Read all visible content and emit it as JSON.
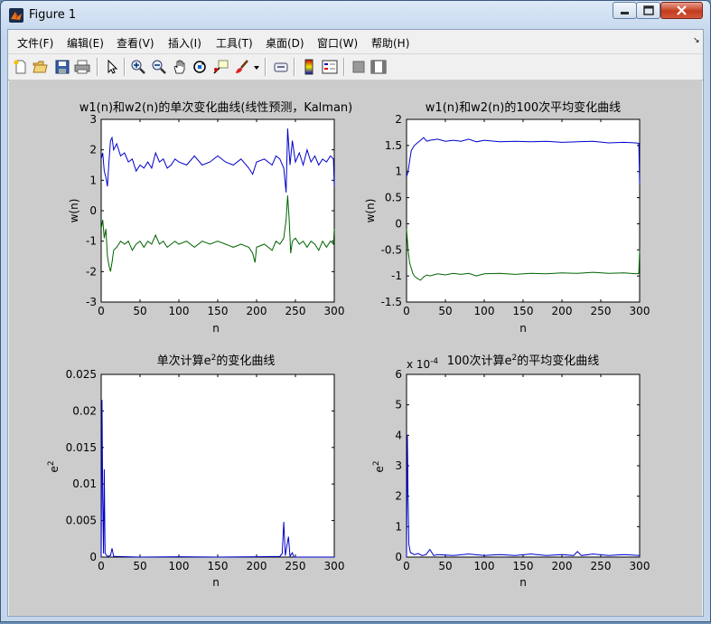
{
  "window": {
    "title": "Figure 1"
  },
  "menu": [
    "文件(F)",
    "编辑(E)",
    "查看(V)",
    "插入(I)",
    "工具(T)",
    "桌面(D)",
    "窗口(W)",
    "帮助(H)"
  ],
  "toolbar_icons": [
    "new-figure-icon",
    "open-icon",
    "save-icon",
    "print-icon",
    "pointer-icon",
    "zoom-in-icon",
    "zoom-out-icon",
    "pan-icon",
    "rotate-3d-icon",
    "data-cursor-icon",
    "brush-icon",
    "dropdown-arrow-icon",
    "link-plot-icon",
    "colorbar-icon",
    "legend-icon",
    "hide-plot-tools-icon",
    "show-plot-tools-icon"
  ],
  "colors": {
    "series1": "#0000cc",
    "series2": "#006400",
    "figure_bg": "#cccccc"
  },
  "chart_data": [
    {
      "type": "line",
      "title": "w1(n)和w2(n)的单次变化曲线(线性预测，Kalman)",
      "xlabel": "n",
      "ylabel": "w(n)",
      "xlim": [
        0,
        300
      ],
      "ylim": [
        -3,
        3
      ],
      "xticks": [
        "0",
        "50",
        "100",
        "150",
        "200",
        "250",
        "300"
      ],
      "yticks": [
        "-3",
        "-2",
        "-1",
        "0",
        "1",
        "2",
        "3"
      ],
      "series": [
        {
          "color": "#0000cc",
          "points": [
            [
              0,
              1.7
            ],
            [
              2,
              1.9
            ],
            [
              4,
              1.3
            ],
            [
              6,
              1.1
            ],
            [
              8,
              0.8
            ],
            [
              10,
              1.6
            ],
            [
              12,
              2.3
            ],
            [
              14,
              2.4
            ],
            [
              16,
              2.0
            ],
            [
              20,
              2.2
            ],
            [
              25,
              1.8
            ],
            [
              30,
              1.9
            ],
            [
              35,
              1.6
            ],
            [
              40,
              1.7
            ],
            [
              45,
              1.3
            ],
            [
              50,
              1.5
            ],
            [
              55,
              1.4
            ],
            [
              60,
              1.6
            ],
            [
              65,
              1.4
            ],
            [
              70,
              1.9
            ],
            [
              75,
              1.6
            ],
            [
              80,
              1.7
            ],
            [
              85,
              1.4
            ],
            [
              90,
              1.5
            ],
            [
              95,
              1.7
            ],
            [
              100,
              1.6
            ],
            [
              110,
              1.5
            ],
            [
              120,
              1.8
            ],
            [
              130,
              1.5
            ],
            [
              140,
              1.6
            ],
            [
              150,
              1.8
            ],
            [
              160,
              1.6
            ],
            [
              170,
              1.5
            ],
            [
              180,
              1.7
            ],
            [
              190,
              1.4
            ],
            [
              195,
              1.2
            ],
            [
              200,
              1.6
            ],
            [
              210,
              1.7
            ],
            [
              220,
              1.5
            ],
            [
              225,
              1.8
            ],
            [
              230,
              1.7
            ],
            [
              235,
              1.4
            ],
            [
              238,
              0.6
            ],
            [
              240,
              2.7
            ],
            [
              243,
              1.5
            ],
            [
              246,
              2.3
            ],
            [
              250,
              1.6
            ],
            [
              255,
              1.9
            ],
            [
              260,
              1.5
            ],
            [
              265,
              2.0
            ],
            [
              270,
              1.6
            ],
            [
              275,
              1.8
            ],
            [
              280,
              1.5
            ],
            [
              285,
              1.7
            ],
            [
              290,
              1.6
            ],
            [
              295,
              1.8
            ],
            [
              299,
              1.7
            ],
            [
              300,
              0.8
            ]
          ]
        },
        {
          "color": "#006400",
          "points": [
            [
              0,
              -0.6
            ],
            [
              2,
              -0.3
            ],
            [
              4,
              -0.9
            ],
            [
              6,
              -0.6
            ],
            [
              8,
              -1.5
            ],
            [
              10,
              -1.8
            ],
            [
              12,
              -2.0
            ],
            [
              14,
              -1.7
            ],
            [
              16,
              -1.3
            ],
            [
              20,
              -1.2
            ],
            [
              25,
              -1.0
            ],
            [
              30,
              -1.1
            ],
            [
              35,
              -1.0
            ],
            [
              40,
              -1.3
            ],
            [
              45,
              -1.1
            ],
            [
              50,
              -1.0
            ],
            [
              55,
              -1.2
            ],
            [
              60,
              -1.0
            ],
            [
              65,
              -1.1
            ],
            [
              70,
              -0.8
            ],
            [
              75,
              -1.1
            ],
            [
              80,
              -1.0
            ],
            [
              85,
              -1.2
            ],
            [
              90,
              -1.1
            ],
            [
              95,
              -1.0
            ],
            [
              100,
              -1.1
            ],
            [
              110,
              -1.0
            ],
            [
              120,
              -1.2
            ],
            [
              130,
              -1.0
            ],
            [
              140,
              -1.1
            ],
            [
              150,
              -1.0
            ],
            [
              160,
              -1.1
            ],
            [
              170,
              -1.2
            ],
            [
              180,
              -1.1
            ],
            [
              190,
              -1.2
            ],
            [
              195,
              -1.4
            ],
            [
              198,
              -1.7
            ],
            [
              200,
              -1.2
            ],
            [
              210,
              -1.1
            ],
            [
              220,
              -1.3
            ],
            [
              225,
              -1.0
            ],
            [
              230,
              -1.1
            ],
            [
              235,
              -0.9
            ],
            [
              238,
              -0.3
            ],
            [
              240,
              0.5
            ],
            [
              242,
              -0.3
            ],
            [
              244,
              -1.4
            ],
            [
              246,
              -1.0
            ],
            [
              250,
              -0.9
            ],
            [
              255,
              -1.1
            ],
            [
              260,
              -1.0
            ],
            [
              265,
              -1.2
            ],
            [
              270,
              -1.0
            ],
            [
              275,
              -1.1
            ],
            [
              280,
              -1.3
            ],
            [
              285,
              -1.0
            ],
            [
              290,
              -1.2
            ],
            [
              295,
              -1.0
            ],
            [
              299,
              -1.1
            ],
            [
              300,
              -0.6
            ]
          ]
        }
      ]
    },
    {
      "type": "line",
      "title": "w1(n)和w2(n)的100次平均变化曲线",
      "xlabel": "n",
      "ylabel": "w(n)",
      "xlim": [
        0,
        300
      ],
      "ylim": [
        -1.5,
        2
      ],
      "xticks": [
        "0",
        "50",
        "100",
        "150",
        "200",
        "250",
        "300"
      ],
      "yticks": [
        "-1.5",
        "-1",
        "-0.5",
        "0",
        "0.5",
        "1",
        "1.5",
        "2"
      ],
      "series": [
        {
          "color": "#0000cc",
          "points": [
            [
              0,
              0.9
            ],
            [
              2,
              1.0
            ],
            [
              4,
              1.2
            ],
            [
              6,
              1.4
            ],
            [
              8,
              1.45
            ],
            [
              10,
              1.5
            ],
            [
              14,
              1.55
            ],
            [
              18,
              1.6
            ],
            [
              22,
              1.65
            ],
            [
              26,
              1.58
            ],
            [
              30,
              1.6
            ],
            [
              40,
              1.62
            ],
            [
              50,
              1.58
            ],
            [
              60,
              1.6
            ],
            [
              70,
              1.58
            ],
            [
              80,
              1.62
            ],
            [
              90,
              1.57
            ],
            [
              100,
              1.6
            ],
            [
              120,
              1.57
            ],
            [
              140,
              1.58
            ],
            [
              160,
              1.57
            ],
            [
              180,
              1.58
            ],
            [
              200,
              1.56
            ],
            [
              220,
              1.57
            ],
            [
              240,
              1.58
            ],
            [
              260,
              1.55
            ],
            [
              280,
              1.56
            ],
            [
              295,
              1.55
            ],
            [
              299,
              1.54
            ],
            [
              300,
              0.75
            ]
          ]
        },
        {
          "color": "#006400",
          "points": [
            [
              0,
              -0.1
            ],
            [
              2,
              -0.5
            ],
            [
              4,
              -0.75
            ],
            [
              6,
              -0.85
            ],
            [
              8,
              -0.95
            ],
            [
              10,
              -1.0
            ],
            [
              14,
              -1.05
            ],
            [
              18,
              -1.08
            ],
            [
              22,
              -1.02
            ],
            [
              26,
              -0.98
            ],
            [
              30,
              -1.0
            ],
            [
              40,
              -0.96
            ],
            [
              50,
              -0.98
            ],
            [
              60,
              -0.95
            ],
            [
              70,
              -0.97
            ],
            [
              80,
              -0.95
            ],
            [
              90,
              -1.0
            ],
            [
              100,
              -0.96
            ],
            [
              120,
              -0.95
            ],
            [
              140,
              -0.97
            ],
            [
              160,
              -0.95
            ],
            [
              180,
              -0.96
            ],
            [
              200,
              -0.94
            ],
            [
              220,
              -0.95
            ],
            [
              240,
              -0.93
            ],
            [
              260,
              -0.95
            ],
            [
              280,
              -0.94
            ],
            [
              295,
              -0.96
            ],
            [
              299,
              -0.95
            ],
            [
              300,
              -0.5
            ]
          ]
        }
      ]
    },
    {
      "type": "line",
      "title_parts": [
        "单次计算e",
        "2",
        "的变化曲线"
      ],
      "xlabel": "n",
      "ylabel_parts": [
        "e",
        "2"
      ],
      "xlim": [
        0,
        300
      ],
      "ylim": [
        0,
        0.025
      ],
      "xticks": [
        "0",
        "50",
        "100",
        "150",
        "200",
        "250",
        "300"
      ],
      "yticks": [
        "0",
        "0.005",
        "0.01",
        "0.015",
        "0.02",
        "0.025"
      ],
      "series": [
        {
          "color": "#0000cc",
          "points": [
            [
              0,
              0
            ],
            [
              1,
              0.0215
            ],
            [
              2,
              0.008
            ],
            [
              3,
              0.0005
            ],
            [
              4,
              0.012
            ],
            [
              5,
              0.0005
            ],
            [
              8,
              0.0001
            ],
            [
              12,
              0.0002
            ],
            [
              14,
              0.0012
            ],
            [
              16,
              0.0001
            ],
            [
              50,
              0
            ],
            [
              100,
              5e-05
            ],
            [
              150,
              0
            ],
            [
              200,
              5e-05
            ],
            [
              230,
              0.0001
            ],
            [
              233,
              0.0005
            ],
            [
              235,
              0.0048
            ],
            [
              237,
              0.0002
            ],
            [
              239,
              0.0015
            ],
            [
              241,
              0.0028
            ],
            [
              243,
              0.0001
            ],
            [
              246,
              0.0006
            ],
            [
              248,
              0
            ],
            [
              300,
              0
            ]
          ]
        }
      ]
    },
    {
      "type": "line",
      "title_parts": [
        "100次计算e",
        "2",
        "的平均变化曲线"
      ],
      "exponent_parts": [
        "x 10",
        "-4"
      ],
      "xlabel": "n",
      "ylabel_parts": [
        "e",
        "2"
      ],
      "xlim": [
        0,
        300
      ],
      "ylim": [
        0,
        6
      ],
      "xticks": [
        "0",
        "50",
        "100",
        "150",
        "200",
        "250",
        "300"
      ],
      "yticks": [
        "0",
        "1",
        "2",
        "3",
        "4",
        "5",
        "6"
      ],
      "series": [
        {
          "color": "#0000cc",
          "points": [
            [
              0,
              0
            ],
            [
              1,
              4.0
            ],
            [
              2,
              2.0
            ],
            [
              3,
              0.4
            ],
            [
              5,
              0.15
            ],
            [
              10,
              0.08
            ],
            [
              15,
              0.12
            ],
            [
              20,
              0.05
            ],
            [
              25,
              0.08
            ],
            [
              30,
              0.25
            ],
            [
              35,
              0.05
            ],
            [
              40,
              0.08
            ],
            [
              60,
              0.05
            ],
            [
              80,
              0.1
            ],
            [
              100,
              0.05
            ],
            [
              120,
              0.08
            ],
            [
              140,
              0.05
            ],
            [
              160,
              0.1
            ],
            [
              180,
              0.05
            ],
            [
              200,
              0.08
            ],
            [
              215,
              0.05
            ],
            [
              220,
              0.18
            ],
            [
              225,
              0.05
            ],
            [
              240,
              0.1
            ],
            [
              260,
              0.05
            ],
            [
              280,
              0.08
            ],
            [
              300,
              0.05
            ]
          ]
        }
      ]
    }
  ]
}
